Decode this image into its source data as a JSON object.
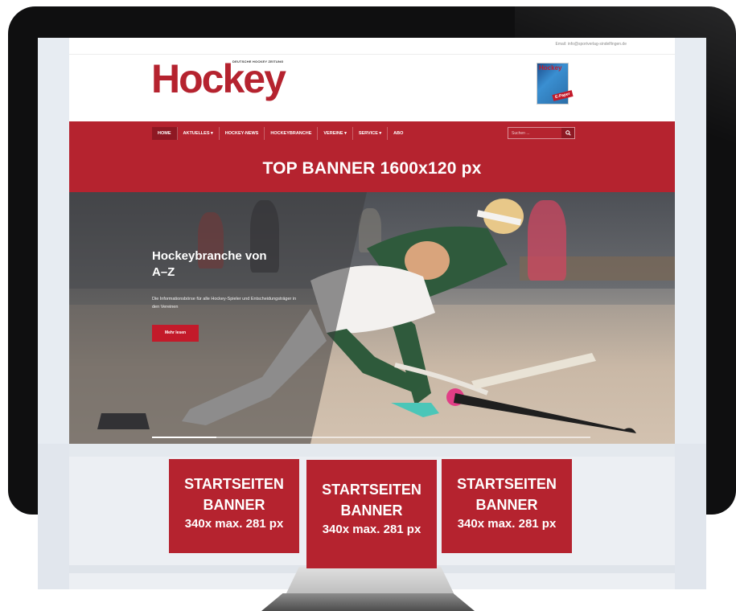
{
  "topbar": {
    "email": "Email: info@sportverlag-sindelfingen.de"
  },
  "header": {
    "logo": "Hockey",
    "logo_tagline": "DEUTSCHE HOCKEY ZEITUNG",
    "epaper_title": "Hockey",
    "epaper_tag": "E-Paper"
  },
  "nav": {
    "items": [
      {
        "label": "HOME",
        "active": true
      },
      {
        "label": "AKTUELLES ▾"
      },
      {
        "label": "HOCKEY-NEWS"
      },
      {
        "label": "HOCKEYBRANCHE"
      },
      {
        "label": "VEREINE ▾"
      },
      {
        "label": "SERVICE ▾"
      },
      {
        "label": "ABO"
      }
    ],
    "search_placeholder": "Suchen ...",
    "search_icon": "search-icon"
  },
  "top_banner": {
    "text": "TOP BANNER 1600x120 px"
  },
  "hero": {
    "title": "Hockeybranche von A–Z",
    "subtitle": "Die Informationsbörse für alle Hockey-Spieler und Entscheidungsträger in den Vereinen",
    "button": "Mehr lesen"
  },
  "banners": [
    {
      "line1": "STARTSEITEN",
      "line2": "BANNER",
      "line3": "340x max. 281 px"
    },
    {
      "line1": "STARTSEITEN",
      "line2": "BANNER",
      "line3": "340x max. 281 px"
    },
    {
      "line1": "STARTSEITEN",
      "line2": "BANNER",
      "line3": "340x max. 281 px"
    }
  ],
  "colors": {
    "brand_red": "#b5232f",
    "dark_red": "#8e1823"
  }
}
